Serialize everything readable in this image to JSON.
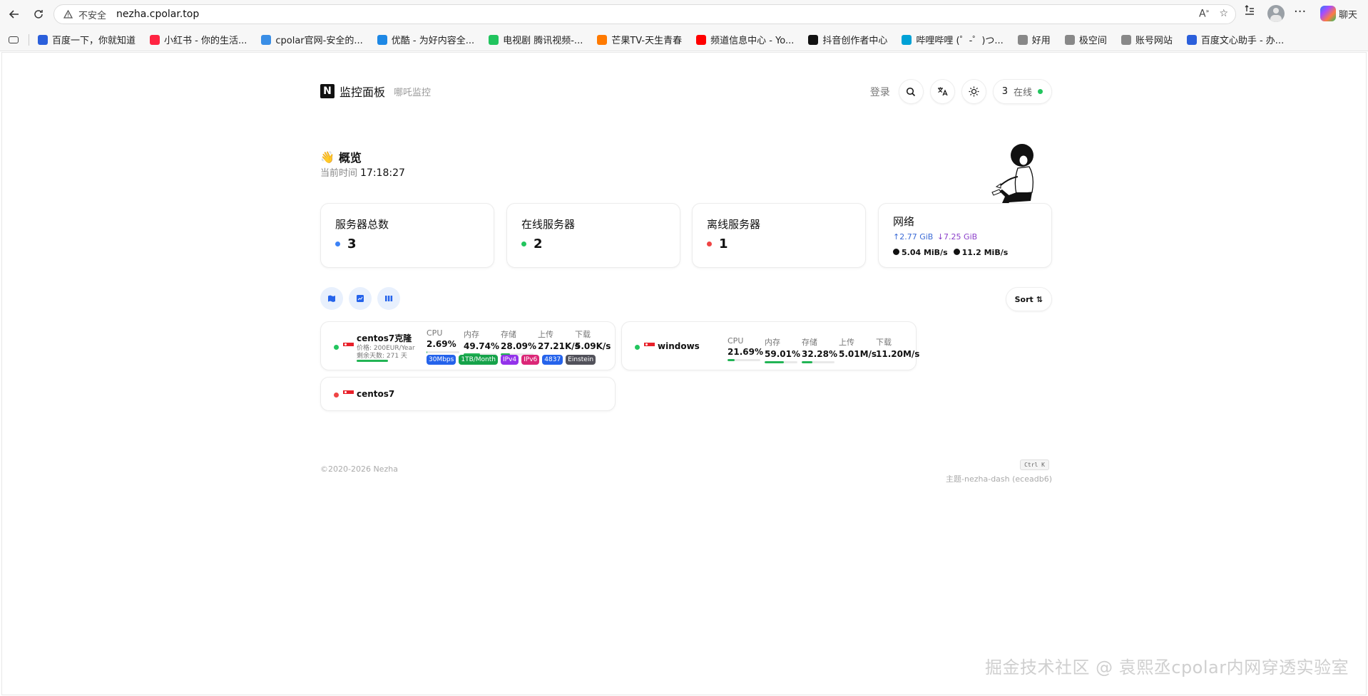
{
  "browser": {
    "insecure_label": "不安全",
    "url": "nezha.cpolar.top",
    "chat_label": "聊天",
    "bookmarks": [
      {
        "label": "百度一下，你就知道",
        "color": "#2b5fdb"
      },
      {
        "label": "小红书 - 你的生活...",
        "color": "#ff2442"
      },
      {
        "label": "cpolar官网-安全的...",
        "color": "#3a8ee6"
      },
      {
        "label": "优酷 - 为好内容全...",
        "color": "#1e88e5"
      },
      {
        "label": "电视剧 腾讯视频-...",
        "color": "#21c45e"
      },
      {
        "label": "芒果TV-天生青春",
        "color": "#ff7a00"
      },
      {
        "label": "频道信息中心 - Yo...",
        "color": "#ff0000"
      },
      {
        "label": "抖音创作者中心",
        "color": "#111111"
      },
      {
        "label": "哔哩哔哩 (゜-゜)つ...",
        "color": "#00a1d6"
      },
      {
        "label": "好用",
        "color": "#888888"
      },
      {
        "label": "极空间",
        "color": "#888888"
      },
      {
        "label": "账号网站",
        "color": "#888888"
      },
      {
        "label": "百度文心助手 - 办...",
        "color": "#2b5fdb"
      }
    ]
  },
  "header": {
    "logo_letter": "N",
    "title": "监控面板",
    "subtitle": "哪吒监控",
    "login": "登录",
    "online_count": "3",
    "online_label": "在线"
  },
  "overview": {
    "emoji": "👋",
    "title": "概览",
    "time_label": "当前时间",
    "time": "17:18:27"
  },
  "stats": [
    {
      "label": "服务器总数",
      "value": "3",
      "color": "#3b82f6"
    },
    {
      "label": "在线服务器",
      "value": "2",
      "color": "#22c55e"
    },
    {
      "label": "离线服务器",
      "value": "1",
      "color": "#ef4444"
    }
  ],
  "network": {
    "label": "网络",
    "upload_total": "↑2.77 GiB",
    "download_total": "↓7.25 GiB",
    "upload_speed": "5.04 MiB/s",
    "download_speed": "11.2 MiB/s"
  },
  "sort_label": "Sort",
  "metric_labels": {
    "cpu": "CPU",
    "mem": "内存",
    "disk": "存储",
    "up": "上传",
    "down": "下载"
  },
  "servers": [
    {
      "name": "centos7克隆",
      "price": "价格: 200EUR/Year",
      "remaining": "剩余天数: 271 天",
      "status_color": "#22c55e",
      "cpu": "2.69%",
      "cpu_pct": 2.69,
      "mem": "49.74%",
      "mem_pct": 49.74,
      "disk": "28.09%",
      "disk_pct": 28.09,
      "up": "27.21K/s",
      "down": "5.09K/s",
      "tags": [
        {
          "label": "30Mbps",
          "color": "#2563eb"
        },
        {
          "label": "1TB/Month",
          "color": "#16a34a"
        },
        {
          "label": "IPv4",
          "color": "#9333ea"
        },
        {
          "label": "IPv6",
          "color": "#db2777"
        },
        {
          "label": "4837",
          "color": "#2563eb"
        },
        {
          "label": "Einstein",
          "color": "#52525b"
        }
      ]
    },
    {
      "name": "windows",
      "status_color": "#22c55e",
      "cpu": "21.69%",
      "cpu_pct": 21.69,
      "mem": "59.01%",
      "mem_pct": 59.01,
      "disk": "32.28%",
      "disk_pct": 32.28,
      "up": "5.01M/s",
      "down": "11.20M/s"
    },
    {
      "name": "centos7",
      "status_color": "#ef4444"
    }
  ],
  "footer": {
    "copyright": "©2020-2026 Nezha",
    "shortcut": "Ctrl K",
    "theme": "主题-nezha-dash (eceadb6)"
  },
  "watermark": "掘金技术社区 @ 袁熙丞cpolar内网穿透实验室"
}
